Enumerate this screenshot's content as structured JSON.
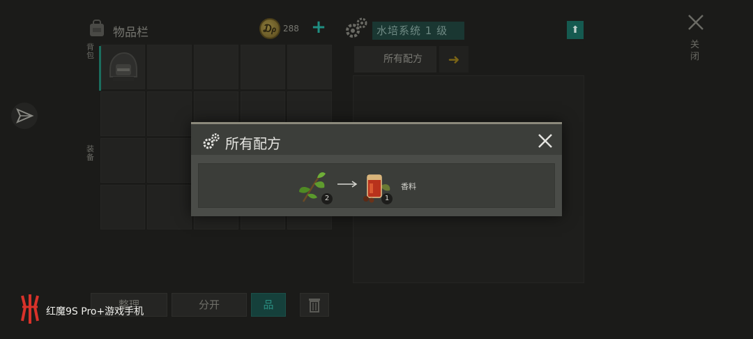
{
  "inventory": {
    "title": "物品栏",
    "coins": "288",
    "add_coins_label": "+",
    "tab_1": "背包",
    "tab_2": "装备",
    "sort_label": "整理",
    "split_label": "分开",
    "layout_label": "品",
    "trash_icon": "trash-icon"
  },
  "crafting": {
    "station_label": "水培系统 1 级",
    "upgrade_label": "⬆",
    "recipes_tab_label": "所有配方",
    "next_arrow": "➜",
    "close_label": "关闭"
  },
  "dialog": {
    "title": "所有配方",
    "recipe": {
      "ingredient_icon": "leaf-branch-icon",
      "ingredient_qty": "2",
      "product_icon": "spice-jar-icon",
      "product_qty": "1",
      "product_name": "香料"
    }
  },
  "watermark": {
    "text": "红魔9S Pro+游戏手机"
  },
  "colors": {
    "accent_teal": "#1f8f82",
    "dialog_bg": "#4a4c48",
    "dialog_header": "#3c3e3a",
    "background": "#1b1b19"
  }
}
